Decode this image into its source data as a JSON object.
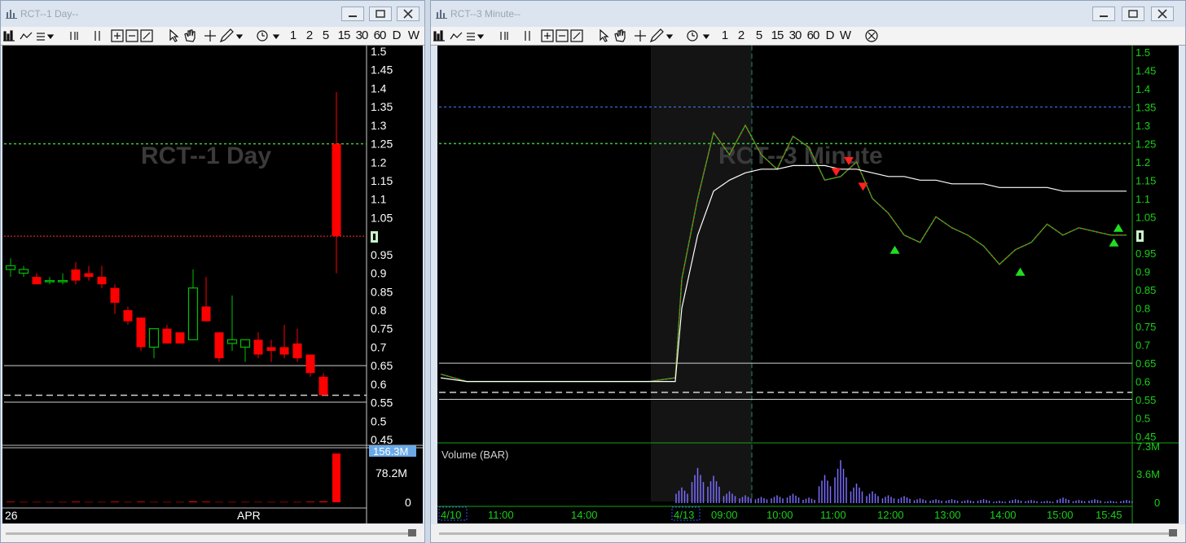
{
  "left": {
    "title": "RCT--1 Day--",
    "watermark": "RCT--1 Day",
    "timeframes": [
      "1",
      "2",
      "5",
      "15",
      "30",
      "60",
      "D",
      "W"
    ],
    "price_labels": [
      "1.5",
      "1.45",
      "1.4",
      "1.35",
      "1.3",
      "1.25",
      "1.2",
      "1.15",
      "1.1",
      "1.05",
      "1",
      "0.95",
      "0.9",
      "0.85",
      "0.8",
      "0.75",
      "0.7",
      "0.65",
      "0.6",
      "0.55",
      "0.5",
      "0.45"
    ],
    "volume_labels": {
      "max": "156.3M",
      "mid": "78.2M",
      "zero": "0"
    },
    "date_labels": [
      "26",
      "APR"
    ],
    "colors": {
      "up": "#00c000",
      "down": "#ff0000",
      "background": "#000000",
      "dotted_green": "#3cc53c",
      "dotted_red": "#ff3030"
    }
  },
  "right": {
    "title": "RCT--3 Minute--",
    "watermark": "RCT--3 Minute",
    "timeframes": [
      "1",
      "2",
      "5",
      "15",
      "30",
      "60",
      "D",
      "W"
    ],
    "price_labels": [
      "1.5",
      "1.45",
      "1.4",
      "1.35",
      "1.3",
      "1.25",
      "1.2",
      "1.15",
      "1.1",
      "1.05",
      "1",
      "0.95",
      "0.9",
      "0.85",
      "0.8",
      "0.75",
      "0.7",
      "0.65",
      "0.6",
      "0.55",
      "0.5",
      "0.45"
    ],
    "volume_title": "Volume (BAR)",
    "volume_labels": {
      "max": "7.3M",
      "mid": "3.6M",
      "zero": "0"
    },
    "time_labels": [
      "4/10",
      "11:00",
      "14:00",
      "4/13",
      "09:00",
      "10:00",
      "11:00",
      "12:00",
      "13:00",
      "14:00",
      "15:00",
      "15:45"
    ],
    "colors": {
      "axis_text": "#18d018",
      "vwap": "#ffffff",
      "blue_line": "#4a7fff",
      "volume": "#7a6cff"
    }
  },
  "chart_data": [
    {
      "type": "candlestick",
      "title": "RCT--1 Day",
      "ylim": [
        0.45,
        1.5
      ],
      "volume_ylim": [
        0,
        156.3
      ],
      "volume_unit": "M",
      "candles": [
        {
          "o": 0.91,
          "h": 0.94,
          "l": 0.89,
          "c": 0.92
        },
        {
          "o": 0.9,
          "h": 0.92,
          "l": 0.89,
          "c": 0.91
        },
        {
          "o": 0.89,
          "h": 0.9,
          "l": 0.87,
          "c": 0.87
        },
        {
          "o": 0.88,
          "h": 0.89,
          "l": 0.87,
          "c": 0.88
        },
        {
          "o": 0.88,
          "h": 0.9,
          "l": 0.87,
          "c": 0.88
        },
        {
          "o": 0.91,
          "h": 0.93,
          "l": 0.87,
          "c": 0.88
        },
        {
          "o": 0.9,
          "h": 0.92,
          "l": 0.88,
          "c": 0.89
        },
        {
          "o": 0.89,
          "h": 0.92,
          "l": 0.86,
          "c": 0.87
        },
        {
          "o": 0.86,
          "h": 0.87,
          "l": 0.79,
          "c": 0.82
        },
        {
          "o": 0.8,
          "h": 0.81,
          "l": 0.76,
          "c": 0.77
        },
        {
          "o": 0.78,
          "h": 0.78,
          "l": 0.69,
          "c": 0.7
        },
        {
          "o": 0.7,
          "h": 0.75,
          "l": 0.67,
          "c": 0.75
        },
        {
          "o": 0.75,
          "h": 0.76,
          "l": 0.71,
          "c": 0.71
        },
        {
          "o": 0.74,
          "h": 0.74,
          "l": 0.71,
          "c": 0.71
        },
        {
          "o": 0.72,
          "h": 0.91,
          "l": 0.72,
          "c": 0.86
        },
        {
          "o": 0.81,
          "h": 0.89,
          "l": 0.77,
          "c": 0.77
        },
        {
          "o": 0.74,
          "h": 0.74,
          "l": 0.66,
          "c": 0.67
        },
        {
          "o": 0.71,
          "h": 0.84,
          "l": 0.69,
          "c": 0.72
        },
        {
          "o": 0.7,
          "h": 0.72,
          "l": 0.66,
          "c": 0.72
        },
        {
          "o": 0.72,
          "h": 0.74,
          "l": 0.67,
          "c": 0.68
        },
        {
          "o": 0.7,
          "h": 0.72,
          "l": 0.66,
          "c": 0.69
        },
        {
          "o": 0.7,
          "h": 0.76,
          "l": 0.67,
          "c": 0.68
        },
        {
          "o": 0.71,
          "h": 0.75,
          "l": 0.66,
          "c": 0.67
        },
        {
          "o": 0.68,
          "h": 0.68,
          "l": 0.62,
          "c": 0.63
        },
        {
          "o": 0.62,
          "h": 0.63,
          "l": 0.57,
          "c": 0.57
        },
        {
          "o": 1.25,
          "h": 1.39,
          "l": 0.9,
          "c": 1.0
        }
      ],
      "volumes": [
        2,
        1,
        1,
        1,
        1,
        2,
        1,
        1,
        2,
        1,
        2,
        1,
        1,
        1,
        3,
        2,
        1,
        1,
        1,
        1,
        1,
        1,
        1,
        2,
        3,
        151
      ],
      "levels": [
        1.25,
        1.0,
        0.65,
        0.57,
        0.56
      ],
      "x_labels": [
        "26",
        "APR"
      ]
    },
    {
      "type": "line",
      "title": "RCT--3 Minute",
      "ylim": [
        0.45,
        1.5
      ],
      "series": [
        {
          "name": "",
          "values": [
            0.62,
            0.6,
            0.6,
            0.6,
            0.6,
            0.6,
            0.6,
            0.6,
            0.6,
            0.61,
            0.88,
            1.1,
            1.28,
            1.22,
            1.3,
            1.22,
            1.18,
            1.27,
            1.24,
            1.15,
            1.16,
            1.2,
            1.1,
            1.06,
            1.0,
            0.98,
            1.05,
            1.02,
            1.0,
            0.97,
            0.92,
            0.96,
            0.98,
            1.03,
            1.0,
            1.02,
            1.01,
            1.0,
            1.0
          ]
        },
        {
          "name": "",
          "values": [
            0.61,
            0.6,
            0.6,
            0.6,
            0.6,
            0.6,
            0.6,
            0.6,
            0.6,
            0.6,
            0.8,
            1.0,
            1.12,
            1.15,
            1.17,
            1.18,
            1.18,
            1.19,
            1.19,
            1.19,
            1.18,
            1.18,
            1.17,
            1.16,
            1.16,
            1.15,
            1.15,
            1.14,
            1.14,
            1.14,
            1.13,
            1.13,
            1.13,
            1.13,
            1.12,
            1.12,
            1.12,
            1.12,
            1.12
          ]
        }
      ],
      "levels": [
        1.35,
        1.25,
        0.65,
        0.57,
        0.56
      ],
      "volume_ylim": [
        0,
        7.3
      ],
      "volume_unit": "M",
      "volume": [
        0,
        0,
        0,
        0,
        0,
        0,
        0,
        0,
        0,
        0,
        2.0,
        4.5,
        3.5,
        1.5,
        1.0,
        0.8,
        1.0,
        1.2,
        0.7,
        3.6,
        5.5,
        2.5,
        1.5,
        1.0,
        0.9,
        0.6,
        0.5,
        0.5,
        0.4,
        0.5,
        0.3,
        0.5,
        0.4,
        0.3,
        0.7,
        0.4,
        0.5,
        0.3,
        0.4
      ],
      "x_labels": [
        "4/10",
        "11:00",
        "14:00",
        "4/13",
        "09:00",
        "10:00",
        "11:00",
        "12:00",
        "13:00",
        "14:00",
        "15:00",
        "15:45"
      ]
    }
  ]
}
